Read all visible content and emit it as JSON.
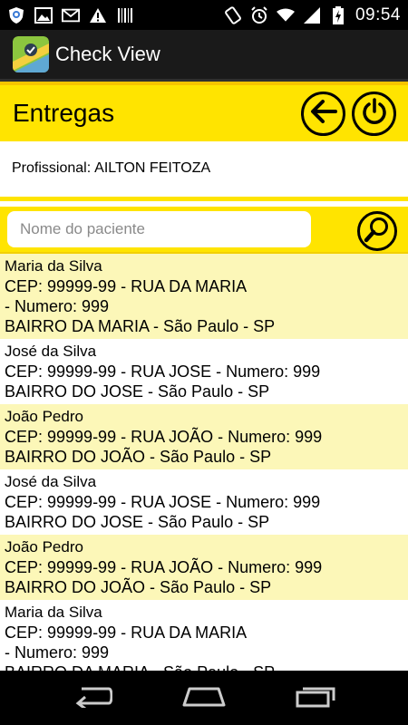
{
  "status_bar": {
    "time": "09:54",
    "left_icons": [
      "shield-icon",
      "image-icon",
      "gmail-icon",
      "warning-icon",
      "barcode-icon"
    ],
    "right_icons": [
      "rotate-icon",
      "alarm-icon",
      "wifi-icon",
      "signal-icon",
      "battery-icon"
    ]
  },
  "app": {
    "title": "Check View"
  },
  "header": {
    "title": "Entregas"
  },
  "profissional": {
    "label": "Profissional:",
    "name": "AILTON FEITOZA"
  },
  "search": {
    "placeholder": "Nome do paciente"
  },
  "colors": {
    "accent": "#ffe400",
    "row_alt": "#fcf7b8"
  },
  "deliveries": [
    {
      "name": "Maria da Silva",
      "line1": "CEP: 99999-99 - RUA DA MARIA",
      "line2": "- Numero: 999",
      "line3": "BAIRRO DA MARIA - São Paulo - SP"
    },
    {
      "name": "José da Silva",
      "line1": "CEP: 99999-99 - RUA JOSE - Numero: 999",
      "line3": "BAIRRO DO JOSE - São Paulo - SP"
    },
    {
      "name": "João Pedro",
      "line1": "CEP: 99999-99 - RUA JOÃO - Numero: 999",
      "line3": "BAIRRO DO JOÃO - São Paulo - SP"
    },
    {
      "name": "José da Silva",
      "line1": "CEP: 99999-99 - RUA JOSE - Numero: 999",
      "line3": "BAIRRO DO JOSE - São Paulo - SP"
    },
    {
      "name": "João Pedro",
      "line1": "CEP: 99999-99 - RUA JOÃO - Numero: 999",
      "line3": "BAIRRO DO JOÃO - São Paulo - SP"
    },
    {
      "name": "Maria da Silva",
      "line1": "CEP: 99999-99 - RUA DA MARIA",
      "line2": "- Numero: 999",
      "line3": "BAIRRO DA MARIA - São Paulo - SP"
    }
  ]
}
